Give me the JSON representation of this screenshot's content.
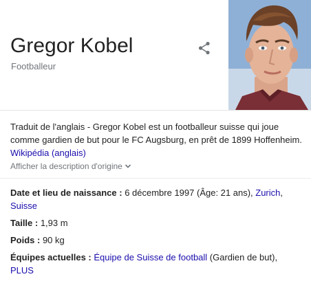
{
  "entity": {
    "name": "Gregor Kobel",
    "type": "Footballeur"
  },
  "description": {
    "text": "Traduit de l'anglais - Gregor Kobel est un footballeur suisse qui joue comme gardien de but pour le FC Augsburg, en prêt de 1899 Hoffenheim. ",
    "source_link": "Wikipédia (anglais)",
    "show_original": "Afficher la description d'origine"
  },
  "facts": {
    "birth": {
      "label": "Date et lieu de naissance :",
      "value": " 6 décembre 1997 (Âge: 21 ans), ",
      "link1": "Zurich",
      "sep": ", ",
      "link2": "Suisse"
    },
    "height": {
      "label": "Taille :",
      "value": " 1,93 m"
    },
    "weight": {
      "label": "Poids :",
      "value": " 90 kg"
    },
    "teams": {
      "label": "Équipes actuelles :",
      "link": "Équipe de Suisse de football",
      "value": " (Gardien de but), ",
      "more": "PLUS"
    }
  },
  "icons": {
    "share": "share-icon",
    "chevron": "chevron-down-icon"
  },
  "colors": {
    "link": "#1a0dab",
    "muted": "#70757a",
    "text": "#222222"
  }
}
